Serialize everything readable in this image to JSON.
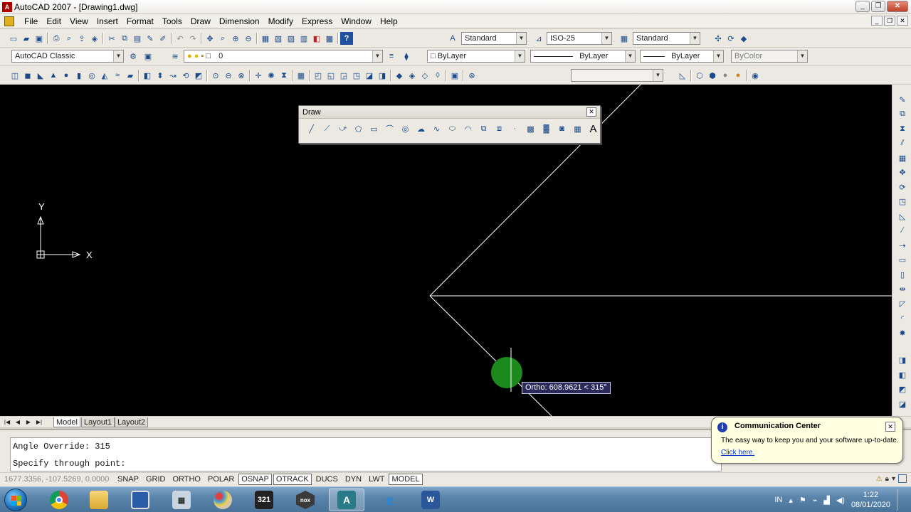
{
  "window": {
    "title": "AutoCAD 2007 - [Drawing1.dwg]",
    "app_icon": "autocad-icon",
    "controls": [
      "minimize",
      "restore",
      "close"
    ]
  },
  "menubar": {
    "items": [
      "File",
      "Edit",
      "View",
      "Insert",
      "Format",
      "Tools",
      "Draw",
      "Dimension",
      "Modify",
      "Express",
      "Window",
      "Help"
    ]
  },
  "toolbars": {
    "styles": {
      "text_style": "Standard",
      "dim_style": "ISO-25",
      "table_style": "Standard"
    },
    "workspace": "AutoCAD Classic",
    "layer": "0",
    "color": "ByLayer",
    "linetype": "ByLayer",
    "lineweight": "ByLayer",
    "plotstyle": "ByColor",
    "render_combo": ""
  },
  "draw_toolbar": {
    "title": "Draw",
    "tools": [
      "line-icon",
      "construction-line-icon",
      "polyline-icon",
      "polygon-icon",
      "rectangle-icon",
      "arc-icon",
      "circle-icon",
      "revision-cloud-icon",
      "spline-icon",
      "ellipse-icon",
      "ellipse-arc-icon",
      "insert-block-icon",
      "make-block-icon",
      "point-icon",
      "hatch-icon",
      "gradient-icon",
      "region-icon",
      "table-icon",
      "multiline-text-icon"
    ]
  },
  "canvas": {
    "ucs_x_label": "X",
    "ucs_y_label": "Y",
    "tooltip": "Ortho: 608.9621 < 315°"
  },
  "layout_tabs": [
    "Model",
    "Layout1",
    "Layout2"
  ],
  "command_window": {
    "lines": [
      "Angle Override: 315",
      "Specify through point:"
    ]
  },
  "statusbar": {
    "coords": "1677.3356, -107.5269, 0.0000",
    "buttons": [
      {
        "label": "SNAP",
        "on": false
      },
      {
        "label": "GRID",
        "on": false
      },
      {
        "label": "ORTHO",
        "on": false
      },
      {
        "label": "POLAR",
        "on": false
      },
      {
        "label": "OSNAP",
        "on": true
      },
      {
        "label": "OTRACK",
        "on": true
      },
      {
        "label": "DUCS",
        "on": false
      },
      {
        "label": "DYN",
        "on": false
      },
      {
        "label": "LWT",
        "on": false
      },
      {
        "label": "MODEL",
        "on": true
      }
    ]
  },
  "balloon": {
    "title": "Communication Center",
    "text": "The easy way to keep you and your software up-to-date.",
    "link": "Click here."
  },
  "taskbar": {
    "apps": [
      "chrome-icon",
      "file-explorer-icon",
      "remote-desktop-icon",
      "calculator-icon",
      "paint-icon",
      "video-editor-icon",
      "nox-icon",
      "autocad-icon",
      "internet-explorer-icon",
      "word-icon"
    ],
    "language": "IN",
    "time": "1:22",
    "date": "08/01/2020"
  },
  "colors": {
    "canvas": "#000000",
    "cad_line": "#ffffff",
    "cursor_marker": "#1c8a1c",
    "tooltip_bg": "#2a2a5a"
  }
}
